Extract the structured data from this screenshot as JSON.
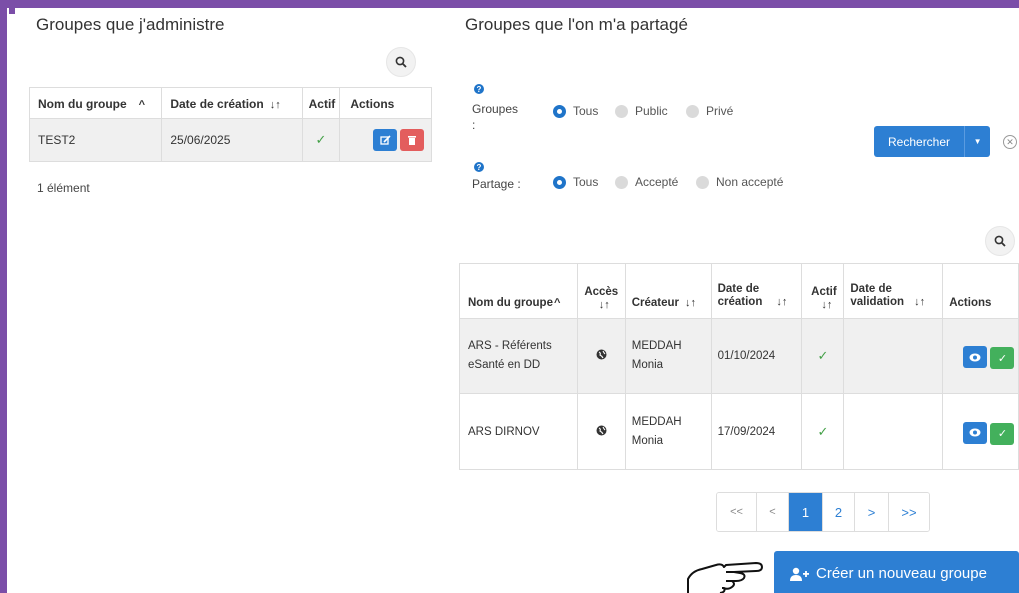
{
  "admin": {
    "title": "Groupes que j'administre",
    "columns": [
      "Nom du groupe",
      "Date de création",
      "Actif",
      "Actions"
    ],
    "rows": [
      {
        "name": "TEST2",
        "date": "25/06/2025",
        "active": "✓"
      }
    ],
    "count": "1 élément"
  },
  "shared": {
    "title": "Groupes que l'on m'a partagé",
    "filters": {
      "groupes_label": "Groupes\n:",
      "groupes_options": [
        "Tous",
        "Public",
        "Privé"
      ],
      "partage_label": "Partage :",
      "partage_options": [
        "Tous",
        "Accepté",
        "Non accepté"
      ]
    },
    "search_button": "Rechercher",
    "columns": {
      "name": "Nom du groupe",
      "access": "Accès",
      "creator": "Créateur",
      "created": "Date de\ncréation",
      "active": "Actif",
      "validated": "Date de\nvalidation",
      "actions": "Actions"
    },
    "rows": [
      {
        "name": "ARS - Référents\neSanté en DD",
        "creator": "MEDDAH\nMonia",
        "created": "01/10/2024",
        "active": "✓",
        "validated": ""
      },
      {
        "name": "ARS DIRNOV",
        "creator": "MEDDAH\nMonia",
        "created": "17/09/2024",
        "active": "✓",
        "validated": ""
      }
    ],
    "pagination": [
      "<<",
      "<",
      "1",
      "2",
      ">",
      ">>"
    ],
    "create_button": "Créer un nouveau groupe"
  },
  "icons": {
    "search": "magnifier-icon",
    "edit": "edit-icon",
    "delete": "trash-icon",
    "view": "eye-icon",
    "accept": "check-icon",
    "globe": "globe-icon",
    "help": "question-icon",
    "pointer": "hand-pointer-icon"
  },
  "colors": {
    "primary": "#2d7fd3",
    "danger": "#e35d5d",
    "success": "#43b05c",
    "frame": "#7b4ea8"
  }
}
